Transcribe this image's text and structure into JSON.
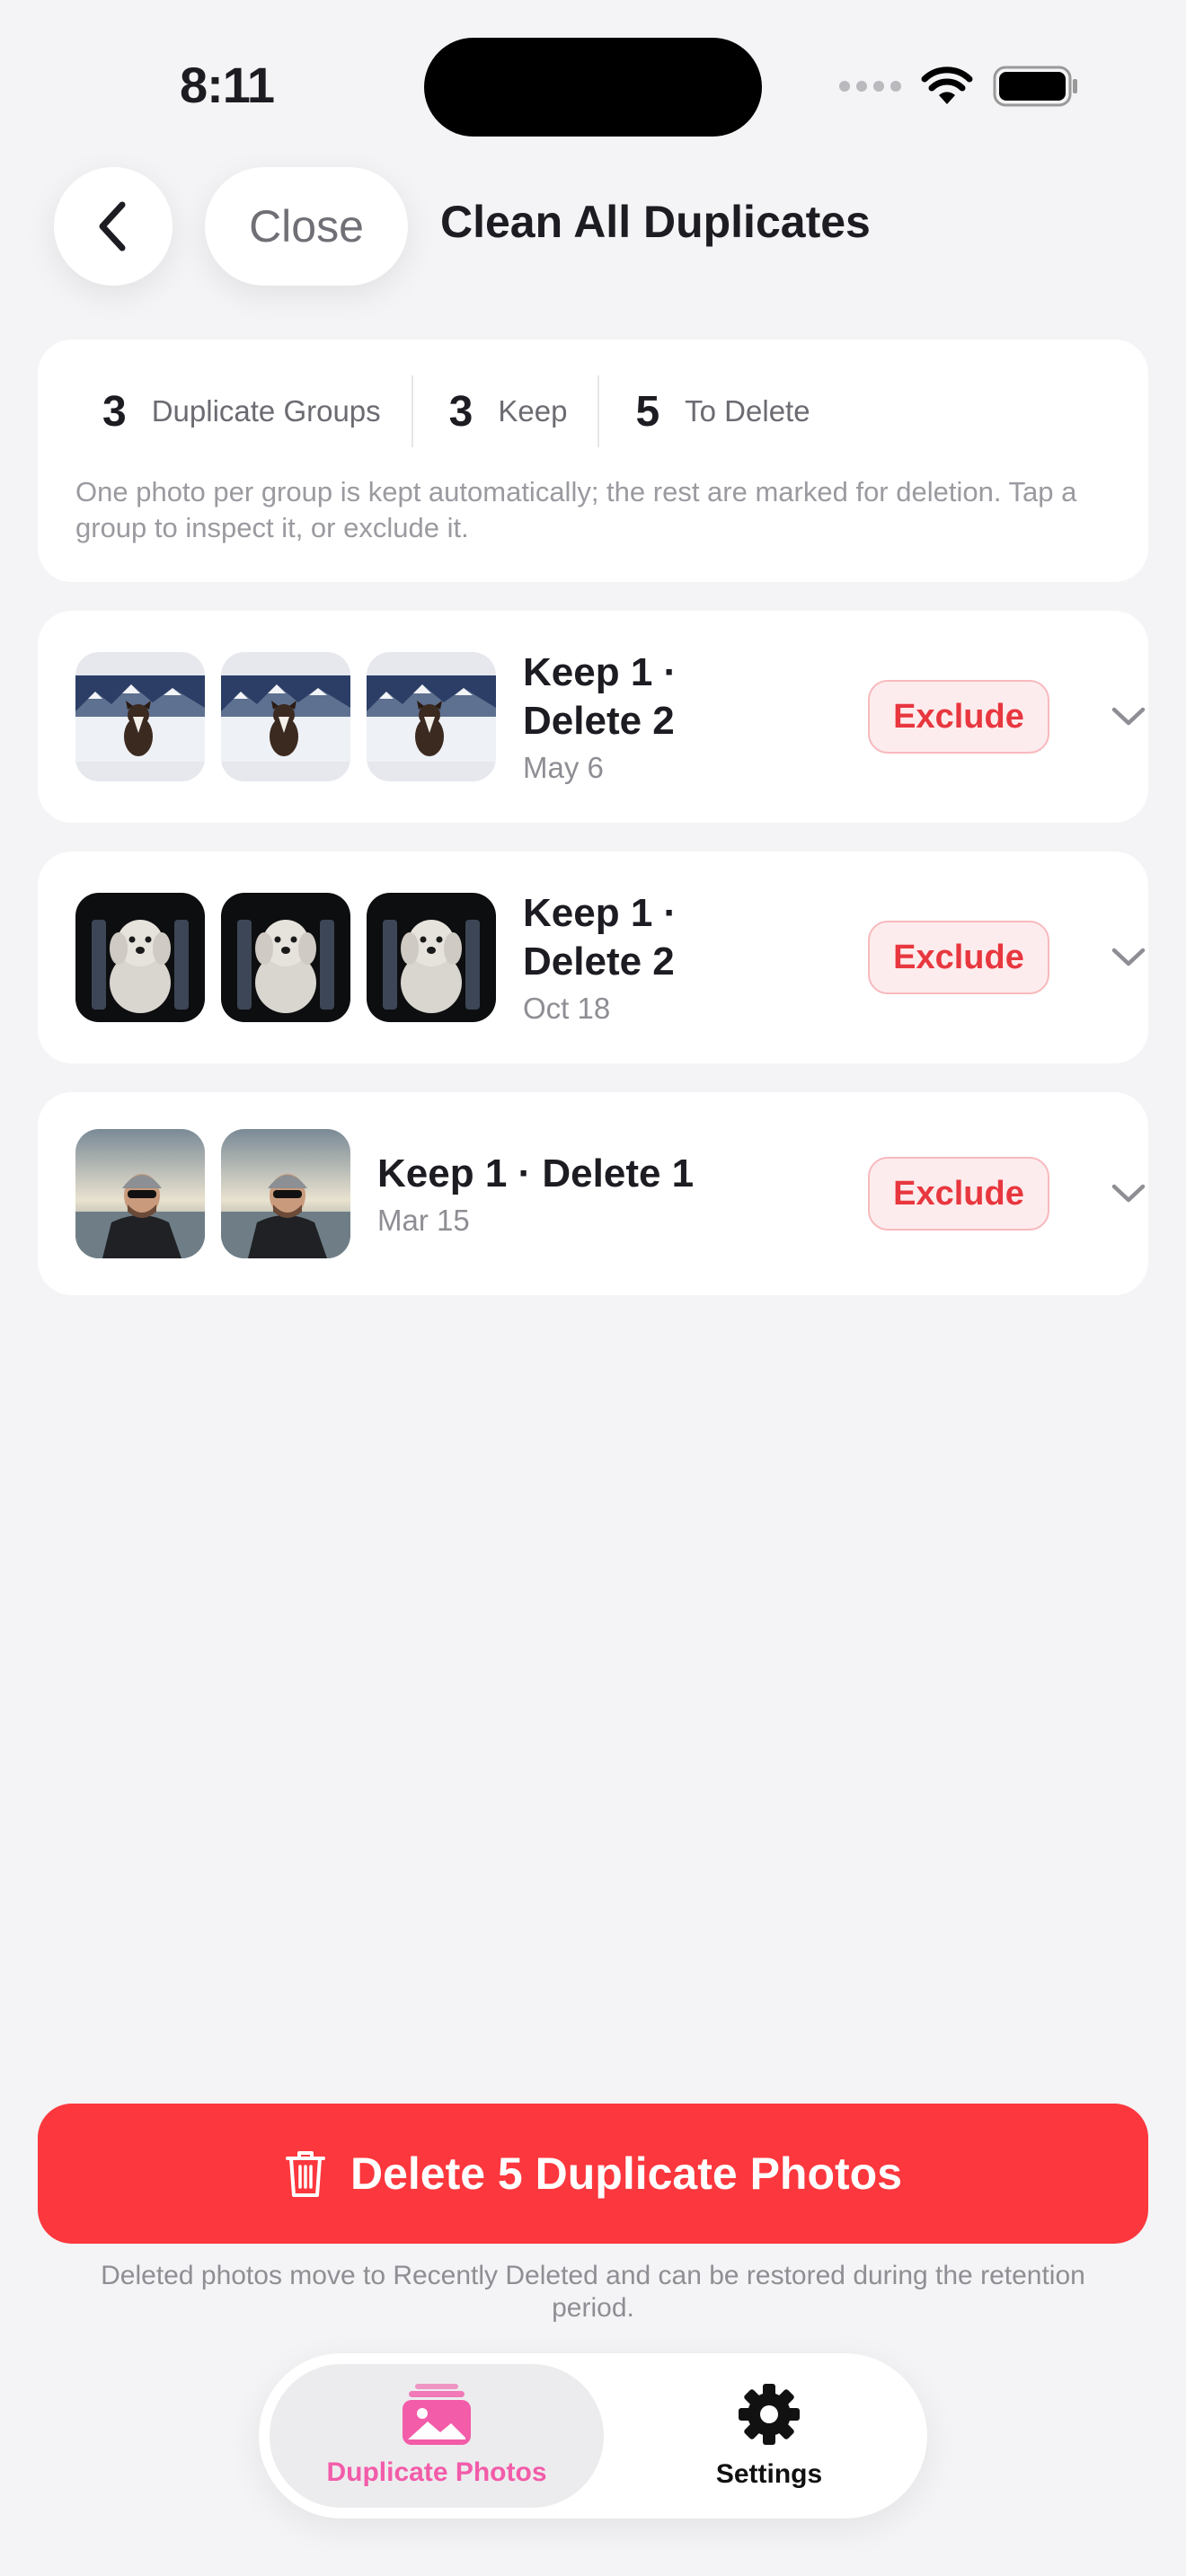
{
  "status_bar": {
    "time": "8:11"
  },
  "nav": {
    "back_icon": "chevron-left-icon",
    "close_label": "Close",
    "title": "Clean All Duplicates"
  },
  "summary": {
    "stats": [
      {
        "value": "3",
        "label": "Duplicate Groups"
      },
      {
        "value": "3",
        "label": "Keep"
      },
      {
        "value": "5",
        "label": "To Delete"
      }
    ],
    "note": "One photo per group is kept automatically; the rest are marked for deletion. Tap a group to inspect it, or exclude it."
  },
  "groups": [
    {
      "title_line1": "Keep 1 ·",
      "title_line2": "Delete 2",
      "date": "May 6",
      "exclude_label": "Exclude",
      "photo_count": 3,
      "subject": "dog in snowy mountains"
    },
    {
      "title_line1": "Keep 1 ·",
      "title_line2": "Delete 2",
      "date": "Oct 18",
      "exclude_label": "Exclude",
      "photo_count": 3,
      "subject": "white curly dog on chair"
    },
    {
      "title_line1": "Keep 1 · Delete 1",
      "title_line2": "",
      "date": "Mar 15",
      "exclude_label": "Exclude",
      "photo_count": 2,
      "subject": "man in beanie by the sea"
    }
  ],
  "delete_button": {
    "label": "Delete 5 Duplicate Photos",
    "icon": "trash-icon"
  },
  "delete_note": "Deleted photos move to Recently Deleted and can be restored during the retention period.",
  "tabbar": {
    "tabs": [
      {
        "label": "Duplicate Photos",
        "icon": "photos-stack-icon",
        "active": true
      },
      {
        "label": "Settings",
        "icon": "gear-icon",
        "active": false
      }
    ]
  },
  "colors": {
    "background": "#f4f4f6",
    "destructive": "#fc373d",
    "exclude_text": "#e8373f",
    "accent_pink": "#f25ca9"
  }
}
